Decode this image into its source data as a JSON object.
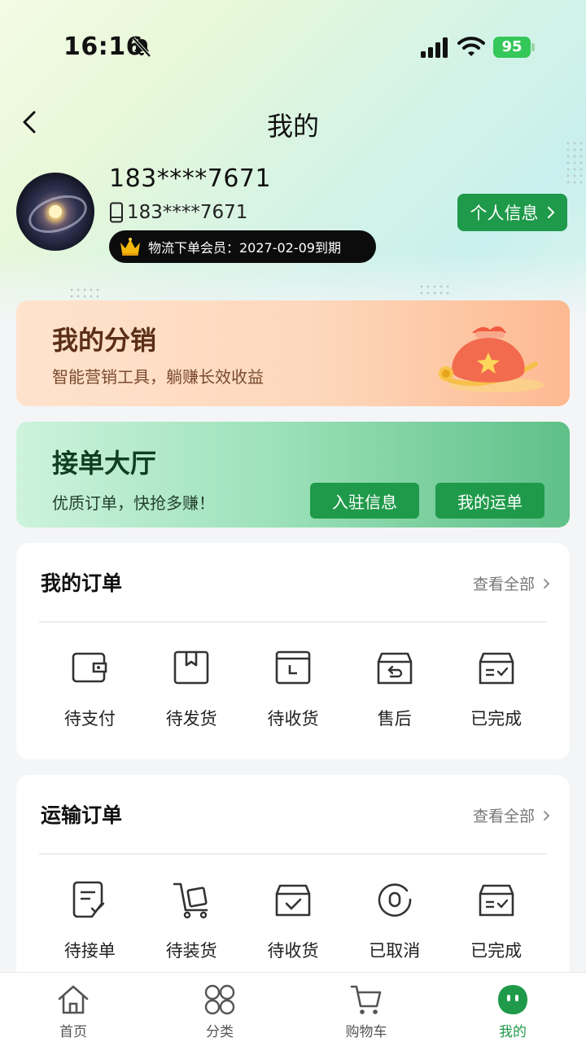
{
  "status_bar": {
    "time": "16:16",
    "battery": "95"
  },
  "nav": {
    "title": "我的"
  },
  "profile": {
    "name": "183****7671",
    "phone": "183****7671",
    "vip_text": "物流下单会员：2027-02-09到期",
    "info_button": "个人信息"
  },
  "distribution_banner": {
    "title": "我的分销",
    "subtitle": "智能营销工具，躺赚长效收益"
  },
  "order_hall_banner": {
    "title": "接单大厅",
    "subtitle": "优质订单，快抢多赚！",
    "buttons": [
      "入驻信息",
      "我的运单"
    ]
  },
  "my_orders": {
    "title": "我的订单",
    "view_all": "查看全部",
    "items": [
      {
        "label": "待支付",
        "icon": "wallet-icon"
      },
      {
        "label": "待发货",
        "icon": "box-icon"
      },
      {
        "label": "待收货",
        "icon": "package-receive-icon"
      },
      {
        "label": "售后",
        "icon": "return-box-icon"
      },
      {
        "label": "已完成",
        "icon": "completed-box-icon"
      }
    ]
  },
  "transport_orders": {
    "title": "运输订单",
    "view_all": "查看全部",
    "items": [
      {
        "label": "待接单",
        "icon": "document-check-icon"
      },
      {
        "label": "待装货",
        "icon": "cart-dolly-icon"
      },
      {
        "label": "待收货",
        "icon": "box-check-icon"
      },
      {
        "label": "已取消",
        "icon": "cancel-circle-icon"
      },
      {
        "label": "已完成",
        "icon": "completed-box-icon"
      }
    ]
  },
  "tabbar": {
    "items": [
      {
        "label": "首页",
        "icon": "home-icon"
      },
      {
        "label": "分类",
        "icon": "category-icon"
      },
      {
        "label": "购物车",
        "icon": "cart-icon"
      },
      {
        "label": "我的",
        "icon": "profile-icon",
        "active": true
      }
    ],
    "active_color": "#1f9a4a"
  },
  "colors": {
    "brand_green": "#1f9a4a",
    "distribution_text": "#5b2e16"
  }
}
